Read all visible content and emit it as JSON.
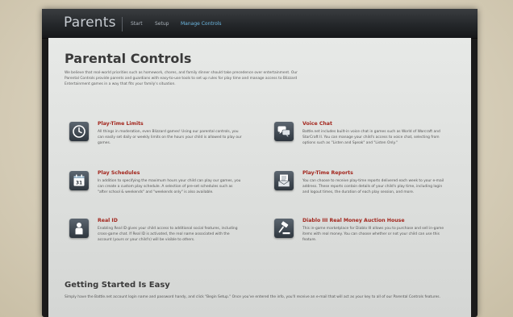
{
  "header": {
    "brand": "Parents",
    "nav": [
      {
        "label": "Start"
      },
      {
        "label": "Setup"
      },
      {
        "label": "Manage Controls"
      }
    ]
  },
  "main": {
    "title": "Parental Controls",
    "intro": "We believe that real-world priorities such as homework, chores, and family dinner should take precedence over entertainment. Our Parental Controls provide parents and guardians with easy-to-use tools to set up rules for play time and manage access to Blizzard Entertainment games in a way that fits your family's situation.",
    "features": [
      {
        "title": "Play-Time Limits",
        "icon": "clock-icon",
        "desc": "All things in moderation, even Blizzard games! Using our parental controls, you can easily set daily or weekly limits on the hours your child is allowed to play our games."
      },
      {
        "title": "Voice Chat",
        "icon": "speech-bubbles-icon",
        "desc": "Battle.net includes built-in voice chat in games such as World of Warcraft and StarCraft II. You can manage your child's access to voice chat, selecting from options such as \"Listen and Speak\" and \"Listen Only.\""
      },
      {
        "title": "Play Schedules",
        "icon": "calendar-icon",
        "desc": "In addition to specifying the maximum hours your child can play our games, you can create a custom play schedule. A selection of pre-set schedules such as \"after school & weekends\" and \"weekends only\" is also available."
      },
      {
        "title": "Play-Time Reports",
        "icon": "envelope-report-icon",
        "desc": "You can choose to receive play-time reports delivered each week to your e-mail address. These reports contain details of your child's play time, including login and logout times, the duration of each play session, and more."
      },
      {
        "title": "Real ID",
        "icon": "user-id-icon",
        "desc": "Enabling Real ID gives your child access to additional social features, including cross-game chat. If Real ID is activated, the real name associated with the account (yours or your child's) will be visible to others."
      },
      {
        "title": "Diablo III Real Money Auction House",
        "icon": "gavel-icon",
        "desc": "This in-game marketplace for Diablo III allows you to purchase and sell in-game items with real money. You can choose whether or not your child can use this feature."
      }
    ],
    "getting_started": {
      "title": "Getting Started Is Easy",
      "desc": "Simply have the Battle.net account login name and password handy, and click \"Begin Setup.\" Once you've entered the info, you'll receive an e-mail that will act as your key to all of our Parental Controls features."
    }
  }
}
